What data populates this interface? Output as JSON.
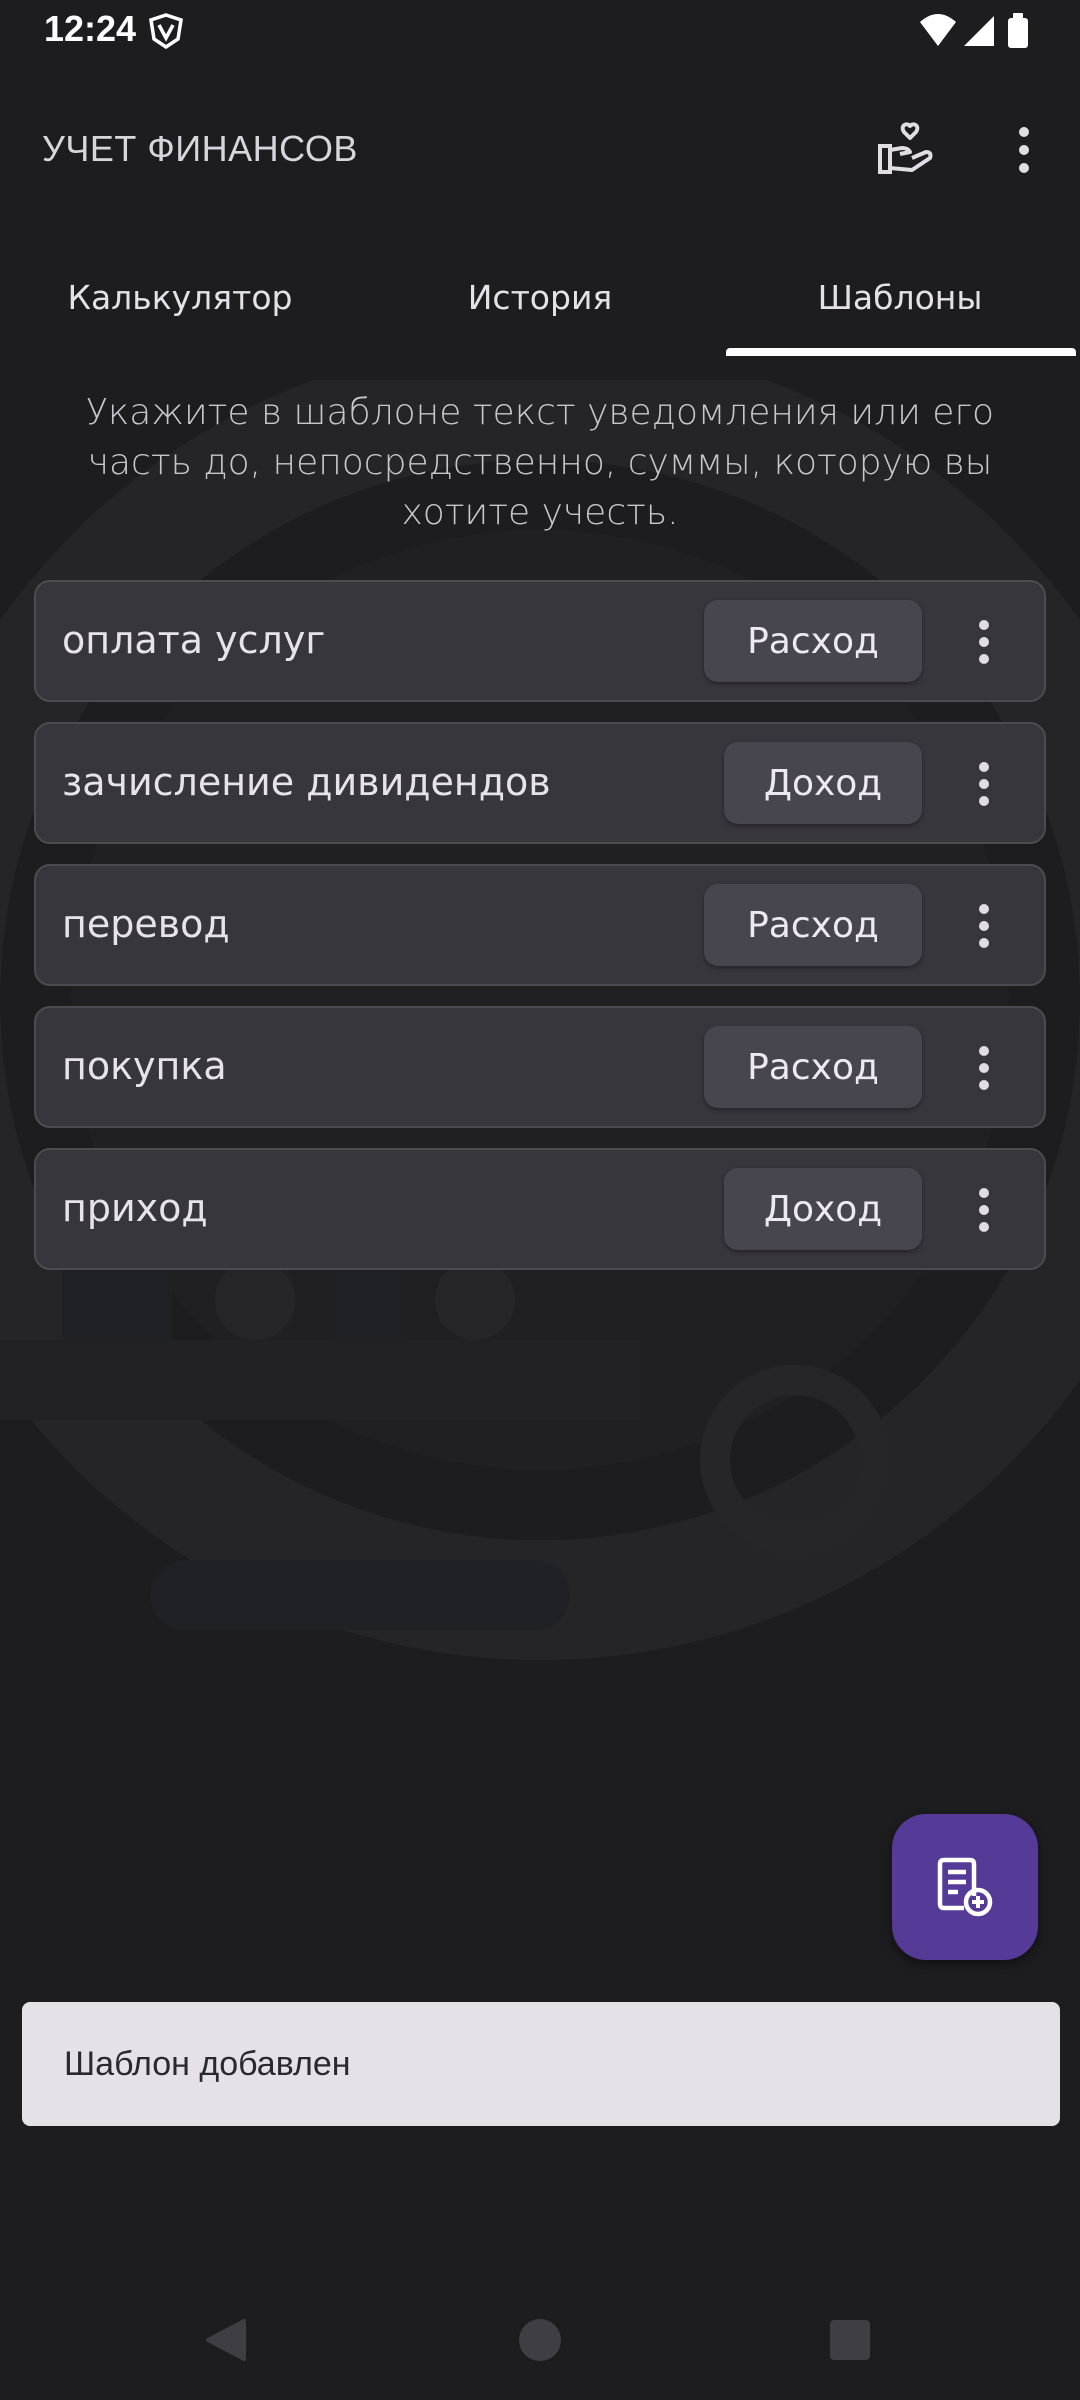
{
  "status_bar": {
    "time": "12:24",
    "vpn_icon": "shield-v-icon",
    "wifi_icon": "wifi-icon",
    "signal_icon": "signal-icon",
    "battery_icon": "battery-icon"
  },
  "app_bar": {
    "title": "УЧЕТ ФИНАНСОВ",
    "donate_icon": "hand-heart-icon",
    "overflow_icon": "more-vert-icon"
  },
  "tabs": [
    {
      "label": "Калькулятор",
      "selected": false
    },
    {
      "label": "История",
      "selected": false
    },
    {
      "label": "Шаблоны",
      "selected": true
    }
  ],
  "hint": "Укажите в шаблоне текст уведомления или его часть до, непосредственно, суммы, которую вы хотите учесть.",
  "templates": [
    {
      "name": "оплата услуг",
      "type": "Расход"
    },
    {
      "name": "зачисление дивидендов",
      "type": "Доход"
    },
    {
      "name": "перевод",
      "type": "Расход"
    },
    {
      "name": "покупка",
      "type": "Расход"
    },
    {
      "name": "приход",
      "type": "Доход"
    }
  ],
  "fab": {
    "icon": "add-note-icon"
  },
  "snackbar": {
    "message": "Шаблон добавлен"
  },
  "nav": {
    "back_icon": "back-triangle-icon",
    "home_icon": "home-circle-icon",
    "recents_icon": "recents-square-icon"
  },
  "colors": {
    "background": "#1d1d20",
    "card": "#38363d",
    "chip": "#47454d",
    "fab": "#563a98",
    "snackbar": "#e6e1e8",
    "tab_indicator": "#ffffff"
  }
}
